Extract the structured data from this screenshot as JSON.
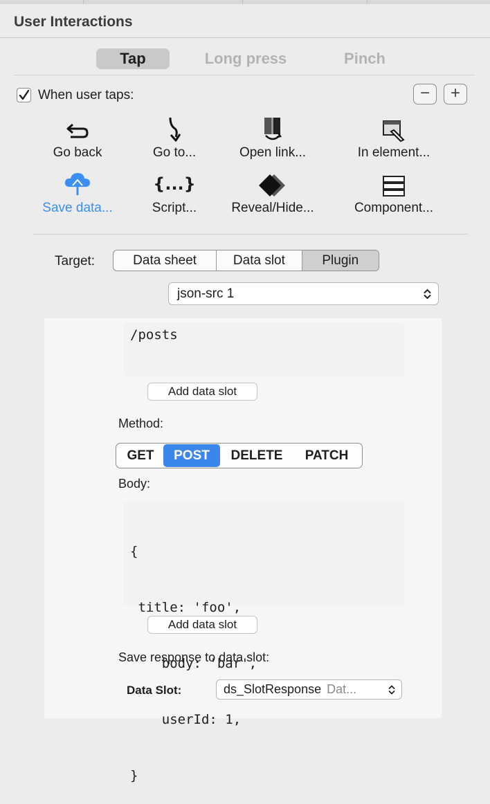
{
  "section": {
    "title": "User Interactions"
  },
  "gesture_tabs": [
    {
      "label": "Tap",
      "active": true
    },
    {
      "label": "Long press",
      "active": false
    },
    {
      "label": "Pinch",
      "active": false
    }
  ],
  "trigger": {
    "label": "When user taps:",
    "checked": true,
    "remove_label": "−",
    "add_label": "+"
  },
  "actions": [
    {
      "label": "Go back",
      "icon": "back-arrow-icon"
    },
    {
      "label": "Go to...",
      "icon": "down-arrow-icon"
    },
    {
      "label": "Open link...",
      "icon": "open-link-icon"
    },
    {
      "label": "In element...",
      "icon": "in-element-icon"
    },
    {
      "label": "Save data...",
      "icon": "cloud-upload-icon",
      "selected": true
    },
    {
      "label": "Script...",
      "icon": "braces-icon"
    },
    {
      "label": "Reveal/Hide...",
      "icon": "diamond-icon"
    },
    {
      "label": "Component...",
      "icon": "component-stack-icon"
    }
  ],
  "target": {
    "label": "Target:",
    "options": [
      "Data sheet",
      "Data slot",
      "Plugin"
    ],
    "selected": "Plugin"
  },
  "plugin_select": {
    "value": "json-src 1"
  },
  "url_field": {
    "value": "/posts"
  },
  "add_slot_label": "Add data slot",
  "method": {
    "label": "Method:",
    "options": [
      "GET",
      "POST",
      "DELETE",
      "PATCH"
    ],
    "selected": "POST"
  },
  "body": {
    "label": "Body:",
    "lines": [
      "{",
      " title: 'foo',",
      "    body: 'bar',",
      "    userId: 1,",
      "}"
    ]
  },
  "response": {
    "label": "Save response to data slot:",
    "slot_label": "Data Slot:",
    "slot_value": "ds_SlotResponse",
    "slot_type": "Dat..."
  },
  "colors": {
    "accent": "#3b86ea",
    "link_blue": "#3b8ef2"
  }
}
